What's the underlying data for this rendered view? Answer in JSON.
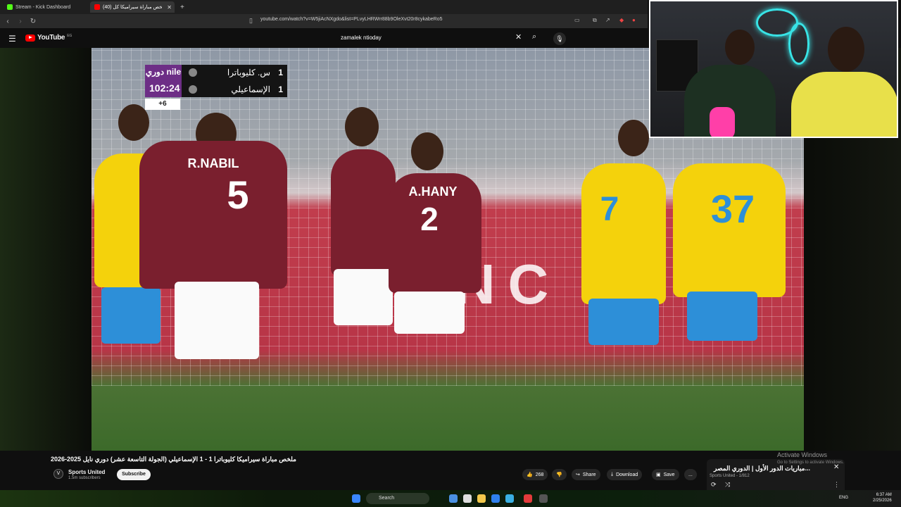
{
  "browser": {
    "tabs": [
      {
        "label": "Stream - Kick Dashboard",
        "favicon_color": "#53fc18",
        "active": false
      },
      {
        "label": "(40) ملخص مباراة سيراميكا كل...",
        "favicon_color": "#ff0000",
        "active": true
      }
    ],
    "new_tab": "+",
    "url": "youtube.com/watch?v=W5jiAcNXgdo&list=PLvyLHRWrr88b9OleXvt20r8cykabeRo5"
  },
  "youtube": {
    "logo_text": "YouTube",
    "country_code": "EG",
    "search_value": "zamalek ntioday"
  },
  "video": {
    "scoreboard": {
      "league_logo": "دوري nile",
      "home_team": "س. كليوباترا",
      "home_score": "1",
      "away_team": "الإسماعيلي",
      "away_score": "1",
      "clock": "102:24",
      "added_time": "+6"
    },
    "players": [
      {
        "name": "R.NABIL",
        "number": "5"
      },
      {
        "name": "A.HANY",
        "number": "2"
      },
      {
        "name": "",
        "number": "37"
      }
    ],
    "title": "ملخص مباراة سيراميكا كليوباترا 1 - 1 الإسماعيلي (الجولة التاسعة عشر) دوري نايل 2025-2026",
    "channel": "Sports United",
    "subscribers": "1.5m subscribers",
    "subscribe_label": "Subscribe",
    "likes": "268",
    "share_label": "Share",
    "download_label": "Download",
    "save_label": "Save",
    "more_label": "..."
  },
  "playlist": {
    "title": "مباريات الدور الأول | الدوري المصر...",
    "meta": "Sports United - 1/812",
    "close": "✕"
  },
  "windows_notice": {
    "line1": "Activate Windows",
    "line2": "Go to Settings to activate Windows."
  },
  "taskbar": {
    "search_placeholder": "Search",
    "lang": "ENG",
    "time": "6:37 AM",
    "date": "2/25/2026"
  },
  "colors": {
    "youtube_red": "#ff0000",
    "zamalek_maroon": "#7a1f2e",
    "ismaily_yellow": "#f4d20c",
    "ismaily_blue": "#2d8fd8",
    "neon": "#38e3e6"
  }
}
